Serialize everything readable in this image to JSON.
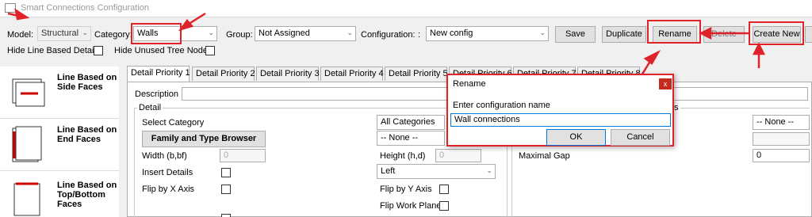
{
  "window": {
    "title": "Smart Connections Configuration"
  },
  "toolbar": {
    "model_label": "Model:",
    "model_value": "Structural",
    "category_label": "Category:",
    "category_value": "Walls",
    "group_label": "Group:",
    "group_value": "Not Assigned",
    "configuration_label": "Configuration:",
    "configuration_extra": ":",
    "configuration_value": "New config",
    "save_label": "Save",
    "duplicate_label": "Duplicate",
    "rename_label": "Rename",
    "delete_label": "Delete",
    "create_new_label": "Create New",
    "hide_line_based_label": "Hide Line Based Details",
    "hide_unused_label": "Hide Unused Tree Nodes"
  },
  "sidebar": {
    "items": [
      {
        "label": "Line Based on Side Faces"
      },
      {
        "label": "Line Based on End Faces"
      },
      {
        "label": "Line Based on Top/Bottom Faces"
      }
    ]
  },
  "tabs": [
    {
      "label": "Detail Priority 1"
    },
    {
      "label": "Detail Priority 2"
    },
    {
      "label": "Detail Priority 3"
    },
    {
      "label": "Detail Priority 4"
    },
    {
      "label": "Detail Priority 5"
    },
    {
      "label": "Detail Priority 6"
    },
    {
      "label": "Detail Priority 7"
    },
    {
      "label": "Detail Priority 8"
    }
  ],
  "detail": {
    "description_label": "Description",
    "group_label": "Detail",
    "select_category_label": "Select Category",
    "all_categories": "All Categories",
    "family_browser_label": "Family and Type Browser",
    "none_value": "-- None --",
    "width_label": "Width (b,bf)",
    "width_value": "0",
    "height_label": "Height (h,d)",
    "height_value": "0",
    "insert_details_label": "Insert Details",
    "alignment_value": "Left",
    "flip_x_label": "Flip by X Axis",
    "flip_y_label": "Flip by Y Axis",
    "flip_work_plane_label": "Flip Work Plane"
  },
  "right_panel": {
    "group_suffix": "ts",
    "none_value": "-- None --",
    "maximal_gap_label": "Maximal Gap",
    "maximal_gap_value": "0"
  },
  "dialog": {
    "title": "Rename",
    "close_glyph": "x",
    "prompt": "Enter configuration name",
    "value": "Wall connections",
    "ok_label": "OK",
    "cancel_label": "Cancel"
  },
  "colors": {
    "highlight": "#e0232b",
    "accent": "#c42b1c"
  }
}
